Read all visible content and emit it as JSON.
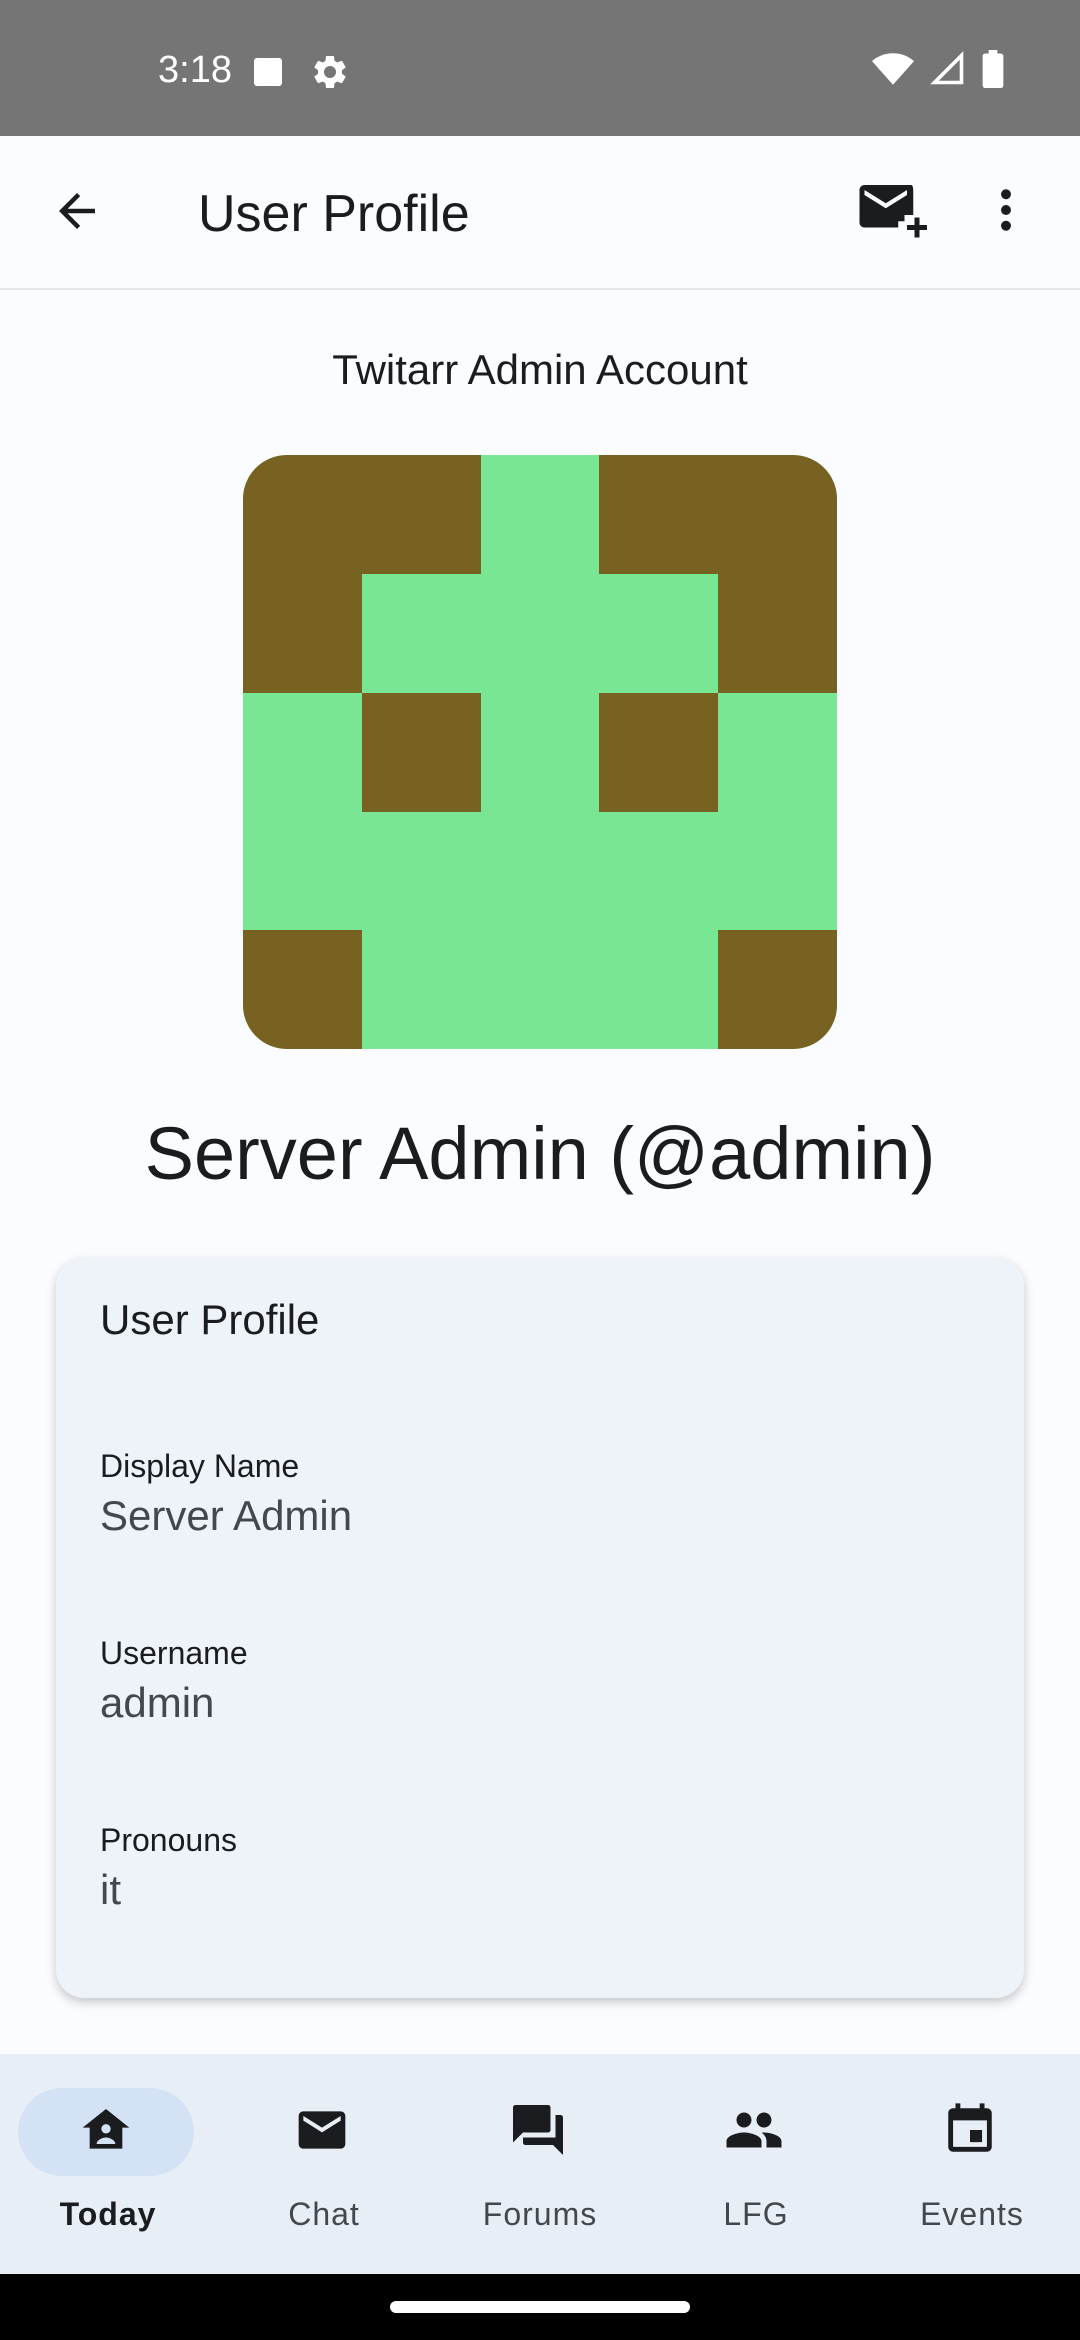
{
  "status_bar": {
    "time": "3:18",
    "left_icons": [
      "notification-square-icon",
      "settings-gear-icon"
    ],
    "right_icons": [
      "wifi-icon",
      "cell-signal-icon",
      "battery-icon"
    ]
  },
  "app_bar": {
    "title": "User Profile",
    "back_icon": "arrow-back-icon",
    "actions": [
      "new-message-icon",
      "more-vert-icon"
    ]
  },
  "profile": {
    "header": "Twitarr Admin Account",
    "name": "Server Admin (@admin)",
    "avatar_colors": {
      "foreground": "#78e692",
      "background": "#786221"
    }
  },
  "card": {
    "title": "User Profile",
    "fields": [
      {
        "label": "Display Name",
        "value": "Server Admin"
      },
      {
        "label": "Username",
        "value": "admin"
      },
      {
        "label": "Pronouns",
        "value": "it"
      }
    ]
  },
  "bottom_nav": {
    "items": [
      {
        "label": "Today",
        "icon": "home-icon",
        "active": true
      },
      {
        "label": "Chat",
        "icon": "mail-icon",
        "active": false
      },
      {
        "label": "Forums",
        "icon": "forum-icon",
        "active": false
      },
      {
        "label": "LFG",
        "icon": "people-icon",
        "active": false
      },
      {
        "label": "Events",
        "icon": "calendar-icon",
        "active": false
      }
    ]
  },
  "colors": {
    "accent_pill": "#d3e3f5",
    "card_bg": "#eef3f9",
    "nav_bg": "#e8eef6"
  }
}
